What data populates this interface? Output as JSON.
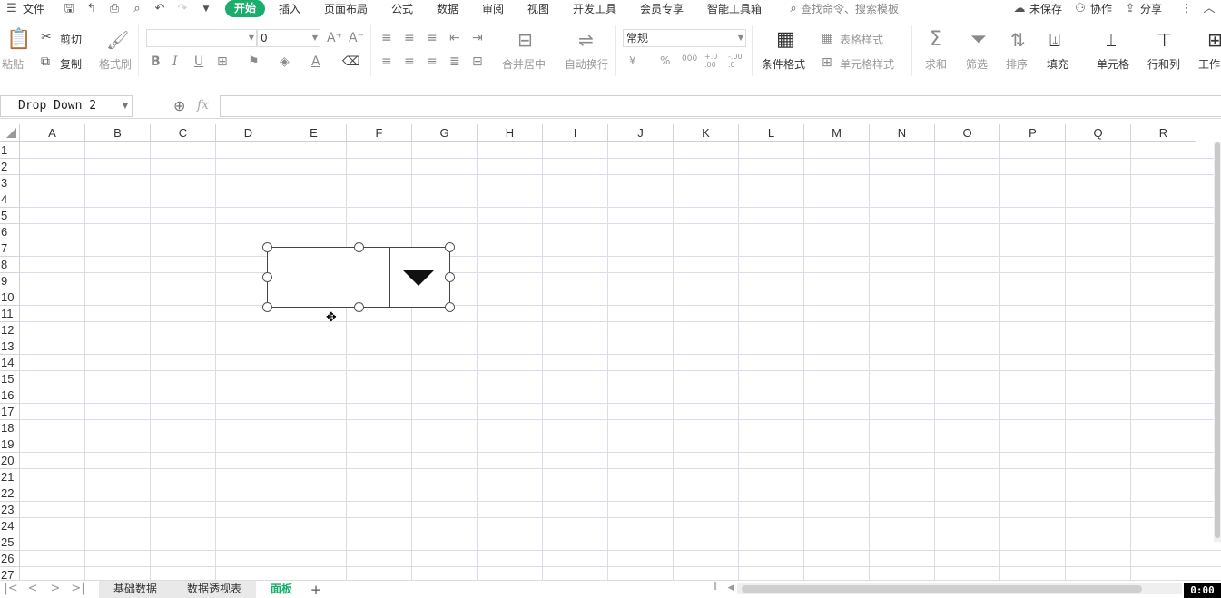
{
  "titlebar": {
    "file_menu": "文件",
    "tabs": [
      "开始",
      "插入",
      "页面布局",
      "公式",
      "数据",
      "审阅",
      "视图",
      "开发工具",
      "会员专享",
      "智能工具箱"
    ],
    "active_tab": "开始",
    "search_placeholder": "查找命令、搜索模板",
    "unsaved": "未保存",
    "collab": "协作",
    "share": "分享"
  },
  "ribbon": {
    "paste": "粘贴",
    "cut": "剪切",
    "copy": "复制",
    "format_painter": "格式刷",
    "font_name": "",
    "font_size": "0",
    "merge_center": "合并居中",
    "wrap_text": "自动换行",
    "number_format": "常规",
    "cond_format": "条件格式",
    "table_style": "表格样式",
    "cell_style": "单元格样式",
    "sum": "求和",
    "filter": "筛选",
    "sort": "排序",
    "fill": "填充",
    "cell": "单元格",
    "row_col": "行和列",
    "worksheet": "工作",
    "currency_sign": "¥",
    "percent_sign": "%",
    "thousands": "000",
    "inc_decimal": "+.0 .00",
    "dec_decimal": "-.00 .0"
  },
  "formula_bar": {
    "name_box": "Drop Down 2",
    "fx_label": "fx",
    "formula_value": ""
  },
  "sheet": {
    "columns": [
      "A",
      "B",
      "C",
      "D",
      "E",
      "F",
      "G",
      "H",
      "I",
      "J",
      "K",
      "L",
      "M",
      "N",
      "O",
      "P",
      "Q",
      "R"
    ],
    "rows": [
      "1",
      "2",
      "3",
      "4",
      "5",
      "6",
      "7",
      "8",
      "9",
      "10",
      "11",
      "12",
      "13",
      "14",
      "15",
      "16",
      "17",
      "18",
      "19",
      "20",
      "21",
      "22",
      "23",
      "24",
      "25",
      "26",
      "27"
    ]
  },
  "sheet_tabs": {
    "tabs": [
      "基础数据",
      "数据透视表",
      "面板"
    ],
    "active": "面板",
    "add_label": "+"
  },
  "timer": "0:00",
  "colors": {
    "accent": "#1aad6b"
  }
}
